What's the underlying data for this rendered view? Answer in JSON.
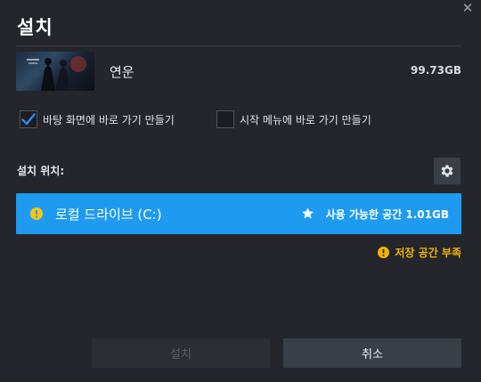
{
  "dialog": {
    "title": "설치",
    "close_glyph": "✕"
  },
  "game": {
    "name": "연운",
    "size": "99.73GB"
  },
  "options": {
    "desktop_shortcut": {
      "label": "바탕 화면에 바로 가기 만들기",
      "checked": true
    },
    "start_menu_shortcut": {
      "label": "시작 메뉴에 바로 가기 만들기",
      "checked": false
    }
  },
  "location": {
    "label": "설치 위치:",
    "drive_name": "로컬 드라이브 (C:)",
    "available_space": "사용 가능한 공간 1.01GB"
  },
  "warning": {
    "text": "저장 공간 부족"
  },
  "buttons": {
    "install": "설치",
    "cancel": "취소"
  },
  "colors": {
    "background": "#24262c",
    "accent": "#1e9bf0",
    "warning": "#f0b400",
    "drive_warning_icon": "#f5c518"
  },
  "icons": {
    "close": "close-icon",
    "check": "checkmark-icon",
    "settings": "gear-icon",
    "drive_warning": "warning-circle-icon",
    "favorite": "star-icon",
    "low_space": "warning-circle-icon"
  }
}
